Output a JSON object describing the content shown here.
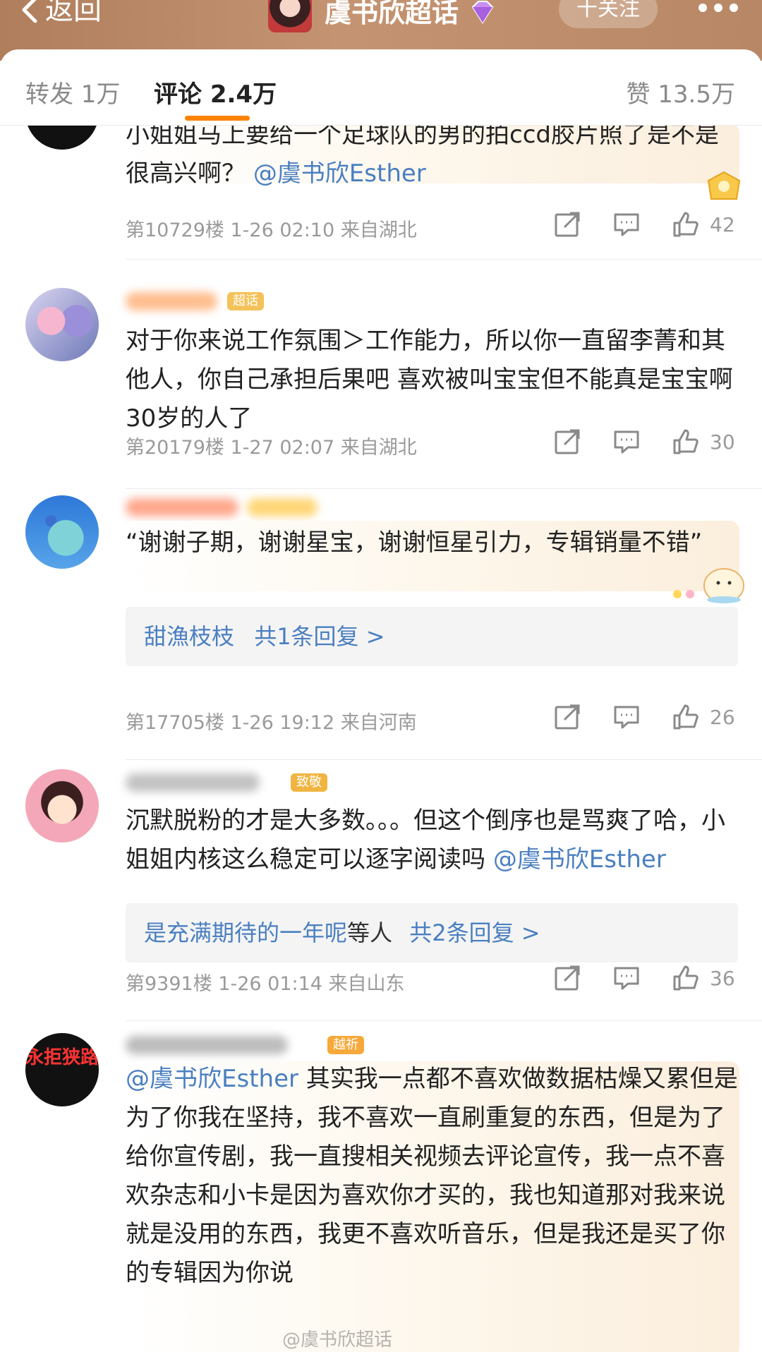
{
  "header": {
    "back_label": "返回",
    "topic_title": "虞书欣超话",
    "follow_label": "十关注",
    "more_icon": "more-dots-icon"
  },
  "tabs": {
    "repost": "转发 1万",
    "comment": "评论 2.4万",
    "like": "赞 13.5万"
  },
  "comments": [
    {
      "text": "小姐姐马上要给一个足球队的男的拍ccd胶片照了是不是很高兴啊？",
      "mention": "@虞书欣Esther",
      "meta": "第10729楼 1-26 02:10 来自湖北",
      "likes": "42"
    },
    {
      "badge": "超话",
      "text": "对于你来说工作氛围＞工作能力，所以你一直留李菁和其他人，你自己承担后果吧 喜欢被叫宝宝但不能真是宝宝啊30岁的人了",
      "meta": "第20179楼 1-27 02:07 来自湖北",
      "likes": "30"
    },
    {
      "text": "“谢谢子期，谢谢星宝，谢谢恒星引力，专辑销量不错”",
      "reply_user": "甜漁枝枝",
      "reply_count": "共1条回复 >",
      "meta": "第17705楼 1-26 19:12 来自河南",
      "likes": "26"
    },
    {
      "badge": "致敬",
      "text": "沉默脱粉的才是大多数。。。但这个倒序也是骂爽了哈，小姐姐内核这么稳定可以逐字阅读吗",
      "mention": "@虞书欣Esther",
      "reply_user": "是充满期待的一年呢",
      "reply_suffix": "等人",
      "reply_count": "共2条回复 >",
      "meta": "第9391楼 1-26 01:14 来自山东",
      "likes": "36"
    },
    {
      "avatar_text": "永拒狭路",
      "badge": "越祈",
      "mention": "@虞书欣Esther",
      "text": " 其实我一点都不喜欢做数据枯燥又累但是为了你我在坚持，我不喜欢一直刷重复的东西，但是为了给你宣传剧，我一直搜相关视频去评论宣传，我一点不喜欢杂志和小卡是因为喜欢你才买的，我也知道那对我来说就是没用的东西，我更不喜欢听音乐，但是我还是买了你的专辑因为你说"
    }
  ],
  "watermark": "@虞书欣超话",
  "colors": {
    "accent": "#ff8200",
    "link": "#4a7fc1",
    "header": "#b88866"
  }
}
